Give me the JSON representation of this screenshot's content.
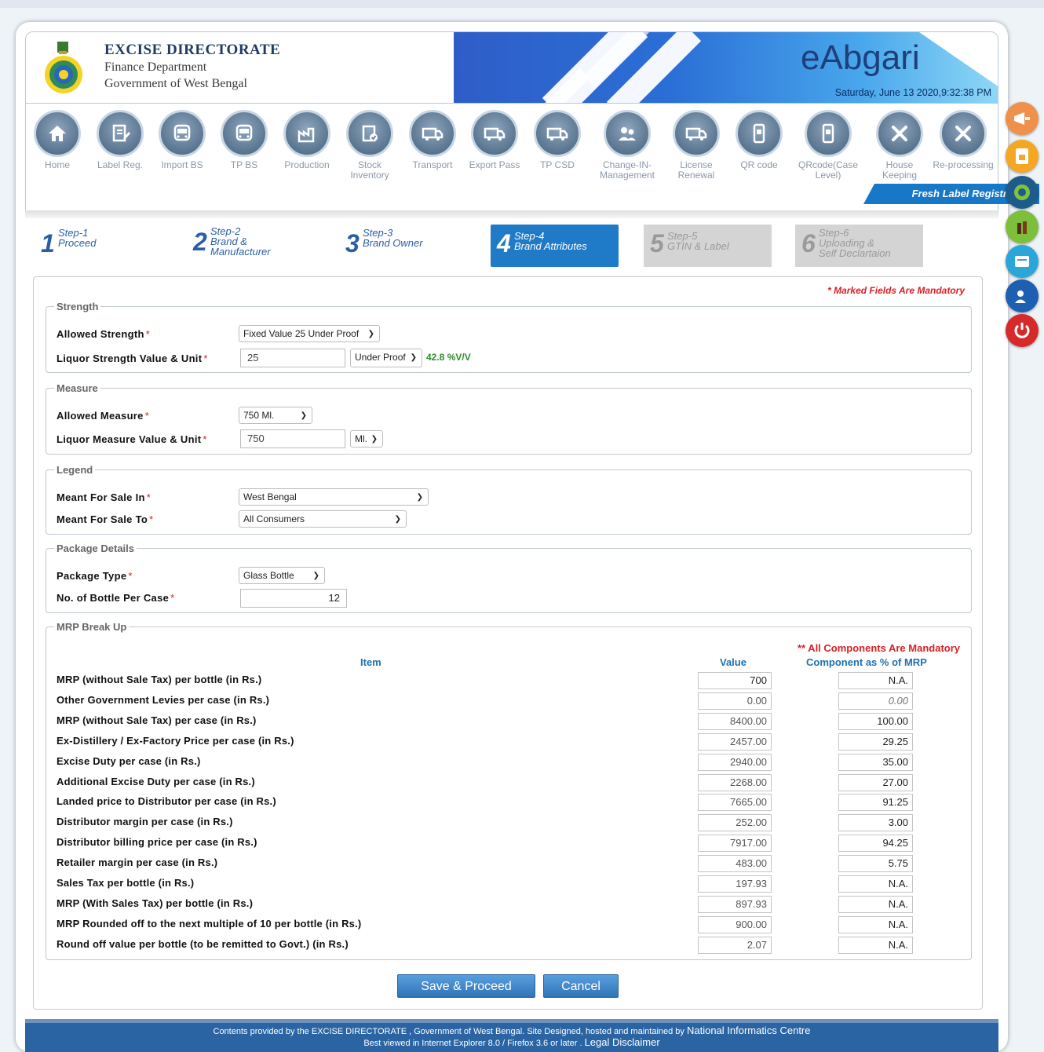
{
  "header": {
    "title": "EXCISE DIRECTORATE",
    "subtitle1": "Finance Department",
    "subtitle2": "Government of West Bengal",
    "brand": "eAbgari",
    "datetime": "Saturday, June 13 2020,9:32:38 PM"
  },
  "nav": [
    {
      "label": "Home",
      "icon": "home-icon"
    },
    {
      "label": "Label Reg.",
      "icon": "document-edit-icon"
    },
    {
      "label": "Import BS",
      "icon": "bus-icon"
    },
    {
      "label": "TP BS",
      "icon": "bus-icon"
    },
    {
      "label": "Production",
      "icon": "factory-icon"
    },
    {
      "label": "Stock Inventory",
      "icon": "clipboard-check-icon"
    },
    {
      "label": "Transport",
      "icon": "truck-icon"
    },
    {
      "label": "Export Pass",
      "icon": "truck-icon"
    },
    {
      "label": "TP CSD",
      "icon": "truck-icon"
    },
    {
      "label": "Change-IN-Management",
      "icon": "people-swap-icon"
    },
    {
      "label": "License Renewal",
      "icon": "truck-icon"
    },
    {
      "label": "QR code",
      "icon": "phone-qr-icon"
    },
    {
      "label": "QRcode(Case Level)",
      "icon": "phone-qr-icon"
    },
    {
      "label": "House Keeping",
      "icon": "tools-icon"
    },
    {
      "label": "Re-processing",
      "icon": "tools-icon"
    }
  ],
  "fresh_label": "Fresh Label Registration",
  "steps": [
    {
      "num": "1",
      "label1": "Step-1",
      "label2": "Proceed",
      "label3": ""
    },
    {
      "num": "2",
      "label1": "Step-2",
      "label2": "Brand &",
      "label3": "Manufacturer"
    },
    {
      "num": "3",
      "label1": "Step-3",
      "label2": "Brand Owner",
      "label3": ""
    },
    {
      "num": "4",
      "label1": "Step-4",
      "label2": "Brand Attributes",
      "label3": ""
    },
    {
      "num": "5",
      "label1": "Step-5",
      "label2": "GTIN & Label",
      "label3": ""
    },
    {
      "num": "6",
      "label1": "Step-6",
      "label2": "Uploading &",
      "label3": "Self Declartaion"
    }
  ],
  "mandatory_note": "* Marked Fields Are Mandatory",
  "strength": {
    "legend": "Strength",
    "allowed_label": "Allowed Strength",
    "allowed_value": "Fixed Value 25 Under Proof",
    "value_label": "Liquor Strength Value & Unit",
    "value": "25",
    "unit": "Under Proof",
    "computed": "42.8 %V/V"
  },
  "measure": {
    "legend": "Measure",
    "allowed_label": "Allowed Measure",
    "allowed_value": "750 Ml.",
    "value_label": "Liquor Measure Value & Unit",
    "value": "750",
    "unit": "Ml."
  },
  "legend_section": {
    "legend": "Legend",
    "sale_in_label": "Meant For Sale In",
    "sale_in_value": "West Bengal",
    "sale_to_label": "Meant For Sale To",
    "sale_to_value": "All Consumers"
  },
  "package": {
    "legend": "Package Details",
    "type_label": "Package Type",
    "type_value": "Glass Bottle",
    "bottles_label": "No. of Bottle Per Case",
    "bottles_value": "12"
  },
  "mrp": {
    "legend": "MRP Break Up",
    "note": "** All Components Are Mandatory",
    "col_item": "Item",
    "col_value": "Value",
    "col_pct": "Component as % of MRP",
    "rows": [
      {
        "item": "MRP (without Sale Tax) per bottle (in Rs.)",
        "value": "700",
        "pct": "N.A."
      },
      {
        "item": "Other Government Levies per case (in Rs.)",
        "value": "0.00",
        "pct": "0.00"
      },
      {
        "item": "MRP (without Sale Tax) per case (in Rs.)",
        "value": "8400.00",
        "pct": "100.00"
      },
      {
        "item": "Ex-Distillery / Ex-Factory Price per case (in Rs.)",
        "value": "2457.00",
        "pct": "29.25"
      },
      {
        "item": "Excise Duty per case (in Rs.)",
        "value": "2940.00",
        "pct": "35.00"
      },
      {
        "item": "Additional Excise Duty per case (in Rs.)",
        "value": "2268.00",
        "pct": "27.00"
      },
      {
        "item": "Landed price to Distributor per case (in Rs.)",
        "value": "7665.00",
        "pct": "91.25"
      },
      {
        "item": "Distributor margin per case (in Rs.)",
        "value": "252.00",
        "pct": "3.00"
      },
      {
        "item": "Distributor billing price per case (in Rs.)",
        "value": "7917.00",
        "pct": "94.25"
      },
      {
        "item": "Retailer margin per case (in Rs.)",
        "value": "483.00",
        "pct": "5.75"
      },
      {
        "item": "Sales Tax per bottle (in Rs.)",
        "value": "197.93",
        "pct": "N.A."
      },
      {
        "item": "MRP (With Sales Tax) per bottle (in Rs.)",
        "value": "897.93",
        "pct": "N.A."
      },
      {
        "item": "MRP Rounded off to the next multiple of 10 per bottle (in Rs.)",
        "value": "900.00",
        "pct": "N.A."
      },
      {
        "item": "Round off value per bottle (to be remitted to Govt.) (in Rs.)",
        "value": "2.07",
        "pct": "N.A."
      }
    ]
  },
  "buttons": {
    "save": "Save & Proceed",
    "cancel": "Cancel"
  },
  "footer": {
    "line1a": "Contents provided by the EXCISE DIRECTORATE , Government of West Bengal. Site Designed, hosted and maintained by",
    "line1b": "National Informatics Centre",
    "line2a": "Best viewed in Internet Explorer 8.0 / Firefox 3.6 or later .",
    "line2b": "Legal Disclaimer"
  },
  "side_icons": [
    "megaphone-icon",
    "document-lock-icon",
    "gear-globe-icon",
    "bottles-icon",
    "card-icon",
    "user-chat-icon",
    "power-icon"
  ],
  "colors": {
    "primary": "#1f7ac7",
    "required": "#d81f26",
    "ok": "#2e8b2e",
    "footer": "#2a64a3"
  }
}
